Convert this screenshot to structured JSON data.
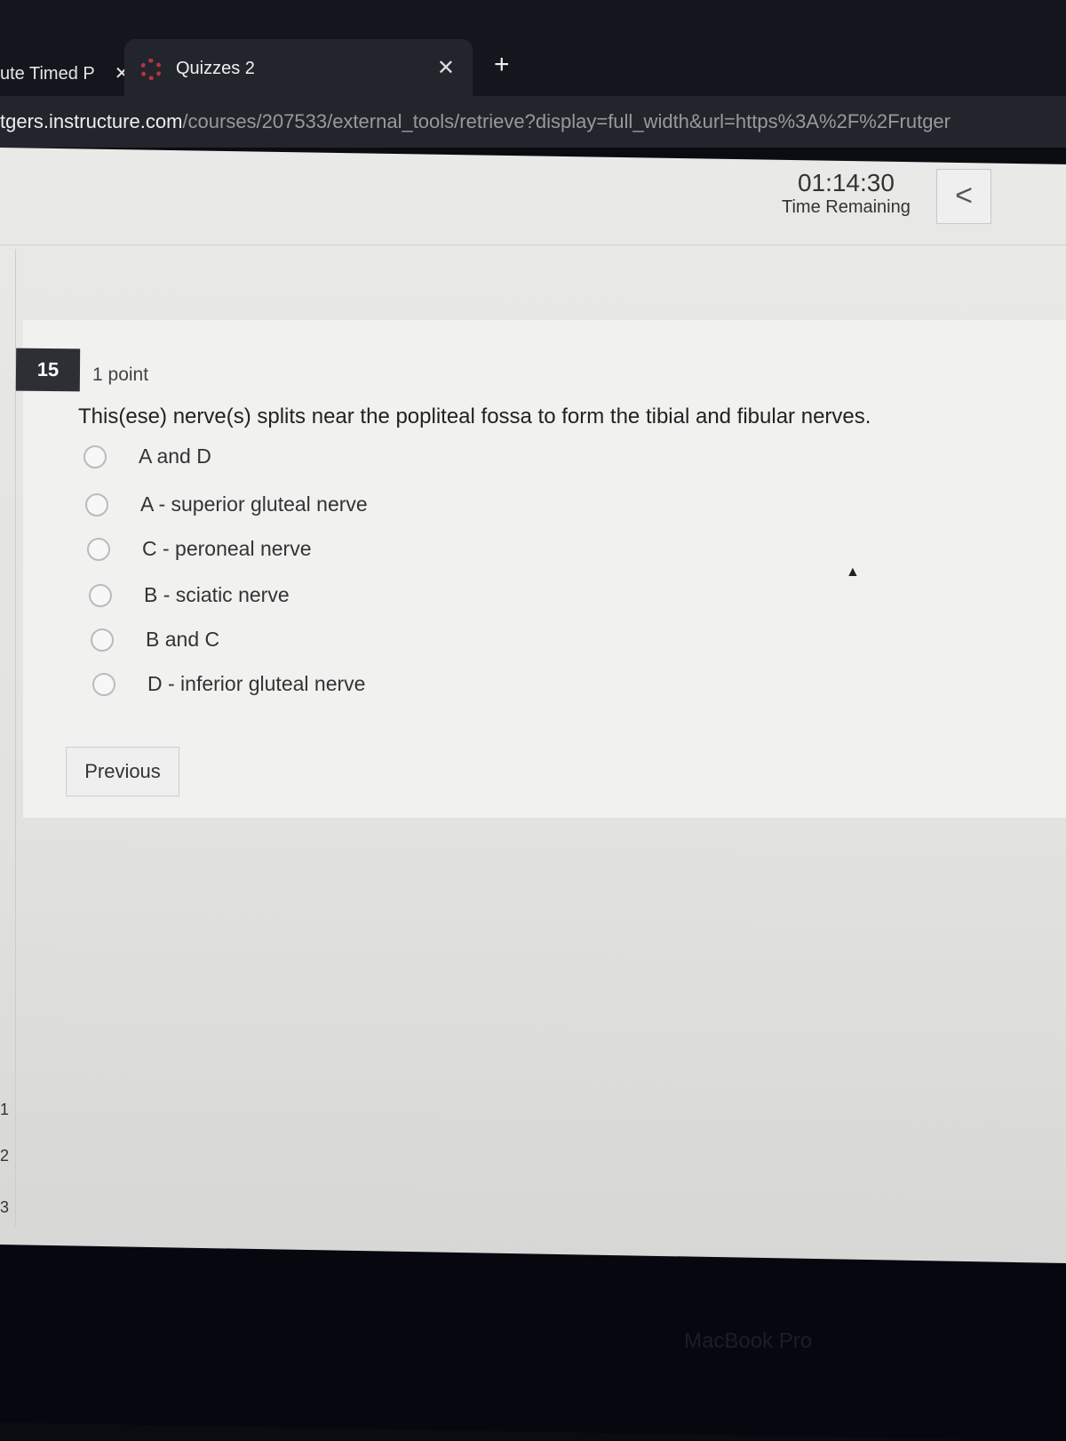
{
  "browser": {
    "tabs": [
      {
        "label": "ute Timed P",
        "close": "✕"
      },
      {
        "label": "Quizzes 2",
        "close": "✕"
      }
    ],
    "new_tab": "+",
    "url_host": "tgers.instructure.com",
    "url_path": "/courses/207533/external_tools/retrieve?display=full_width&url=https%3A%2F%2Frutger"
  },
  "header": {
    "timer": "01:14:30",
    "timer_label": "Time Remaining",
    "collapse": "<"
  },
  "sidebar": {
    "items": [
      "1",
      "2",
      "3"
    ]
  },
  "question": {
    "number": "15",
    "points": "1 point",
    "text": "This(ese) nerve(s) splits near the popliteal fossa to form the tibial and fibular nerves.",
    "options": [
      "A and D",
      "A - superior gluteal nerve",
      "C - peroneal nerve",
      "B - sciatic nerve",
      "B and C",
      "D - inferior gluteal nerve"
    ]
  },
  "nav": {
    "previous": "Previous"
  },
  "device": {
    "brand": "MacBook Pro"
  }
}
